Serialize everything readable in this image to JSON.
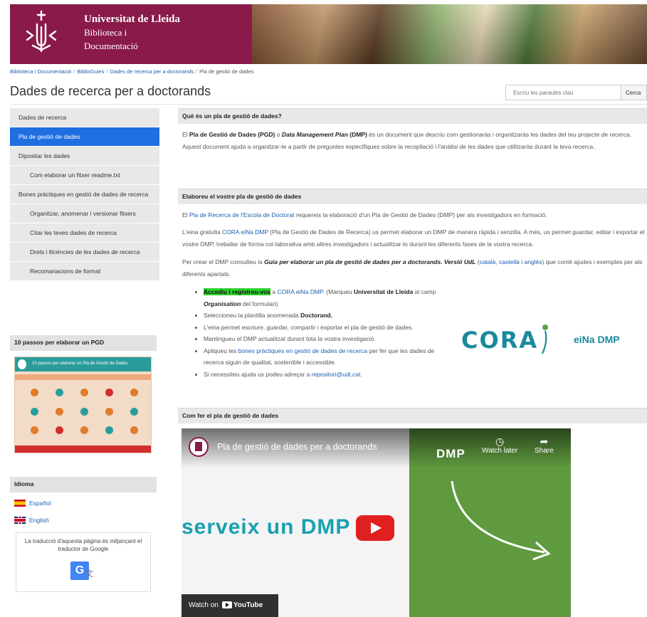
{
  "header": {
    "org_line1": "Universitat de Lleida",
    "org_line2": "Biblioteca i",
    "org_line3": "Documentació",
    "brand_color": "#8a1a4a"
  },
  "breadcrumb": [
    "Biblioteca i Documentació",
    "BiblioGuies",
    "Dades de recerca per a doctorands",
    "Pla de gestió de dades"
  ],
  "page_title": "Dades de recerca per a doctorands",
  "search": {
    "placeholder": "Escriu les paraules clau",
    "button_label": "Cerca"
  },
  "sidebar": {
    "items": [
      {
        "label": "Dades de recerca"
      },
      {
        "label": "Pla de gestió de dades",
        "active": true
      },
      {
        "label": "Dipositar les dades"
      },
      {
        "label": "Com elaborar un fitxer readme.txt",
        "sub": true
      },
      {
        "label": "Bones pràctiques en gestió de dades de recerca"
      },
      {
        "label": "Organitzar, anomenar i versionar fitxers",
        "sub": true
      },
      {
        "label": "Citar les teves dades de recerca",
        "sub": true
      },
      {
        "label": "Drets i llicències de les dades de recerca",
        "sub": true
      },
      {
        "label": "Recomanacions de format",
        "sub": true
      }
    ],
    "pgd_heading": "10 passos per elaborar un PGD",
    "pgd_image_title": "10 passos per elaborar un Pla de Gestió de Dades",
    "lang_heading": "Idioma",
    "lang_es": "Español",
    "lang_en": "English",
    "translate_note": "La traducció d'aquesta pàgina és mitjançant el traductor de Google"
  },
  "sections": {
    "s1_title": "Què és un pla de gestió de dades?",
    "s1_p1_a": "El ",
    "s1_p1_b": "Pla de Gestió de Dades (PGD)",
    "s1_p1_c": " o ",
    "s1_p1_d": "Data Management Plan",
    "s1_p1_e": " (DMP)",
    "s1_p1_f": " és un document que descriu com gestionaràs i organitzaràs les dades del teu projecte de recerca. Aquest document ajuda a organitzar-te a partir de preguntes específiques sobre la recopilació i l'anàlisi de les dades que utilitzaràs durant la teva recerca.",
    "s2_title": "Elaboreu el vostre pla de gestió de dades",
    "s2_p1_a": "El ",
    "s2_p1_link": "Pla de Recerca de l'Escola de Doctorat",
    "s2_p1_b": " requereix la elaboració d'un Pla de Gestió de Dades (DMP) per als investigadors en formació.",
    "s2_p2_a": "L'eina gratuïta ",
    "s2_p2_link": "CORA eiNa DMP",
    "s2_p2_b": " (Pla de Gestió de Dades de Recerca) us permet elaborar un DMP de manera ràpida i senzilla. A més, us permet guardar, editar i exportar el vostre DMP, treballar de forma col·laborativa amb altres investigadors i actualitzar-lo durant les diferents fases de la vostra recerca.",
    "s2_p3_a": "Per crear el DMP consulteu la ",
    "s2_p3_b": "Guia per elaborar un pla de gestió de dades per a doctorands. Versió UdL",
    "s2_p3_c": " (",
    "s2_p3_l1": "català",
    "s2_p3_d": ", ",
    "s2_p3_l2": "castellà",
    "s2_p3_e": " i ",
    "s2_p3_l3": "anglès",
    "s2_p3_f": ") que conté ajudes i exemples per als diferents apartats.",
    "li1_hl": "Accediu i registreu-vos",
    "li1_a": " a ",
    "li1_link": "CORA eiNa DMP",
    "li1_b": ". (Marqueu ",
    "li1_c": "Universitat de Lleida",
    "li1_d": " al camp ",
    "li1_e": "Organisation",
    "li1_f": " del formulari)",
    "li2_a": "Seleccioneu la plantilla anomenada ",
    "li2_b": "Doctorand.",
    "li3": "L'eina permet escriure, guardar, compartir i exportar el pla de gestió de dades.",
    "li4": "Mantingueu el DMP actualitzat durant tota la vostra investigació.",
    "li5_a": "Apliqueu les ",
    "li5_link": "bones pràctiques en gestió de dades de recerca",
    "li5_b": " per fer que les dades de recerca siguin de qualitat, sostenible i accessible.",
    "li6_a": "Si necessiteu ajuda us podeu adreçar a ",
    "li6_link": "repositori@udl.cat",
    "li6_b": ".",
    "cora_word": "CORA",
    "cora_sub": "eiNa DMP",
    "s3_title": "Com fer el pla de gestió de dades"
  },
  "video": {
    "title": "Pla de gestió de dades per a doctorands",
    "watch_later": "Watch later",
    "share": "Share",
    "dmp": "DMP",
    "big_text": "serveix un DMP",
    "watch_on": "Watch on",
    "youtube": "YouTube"
  }
}
